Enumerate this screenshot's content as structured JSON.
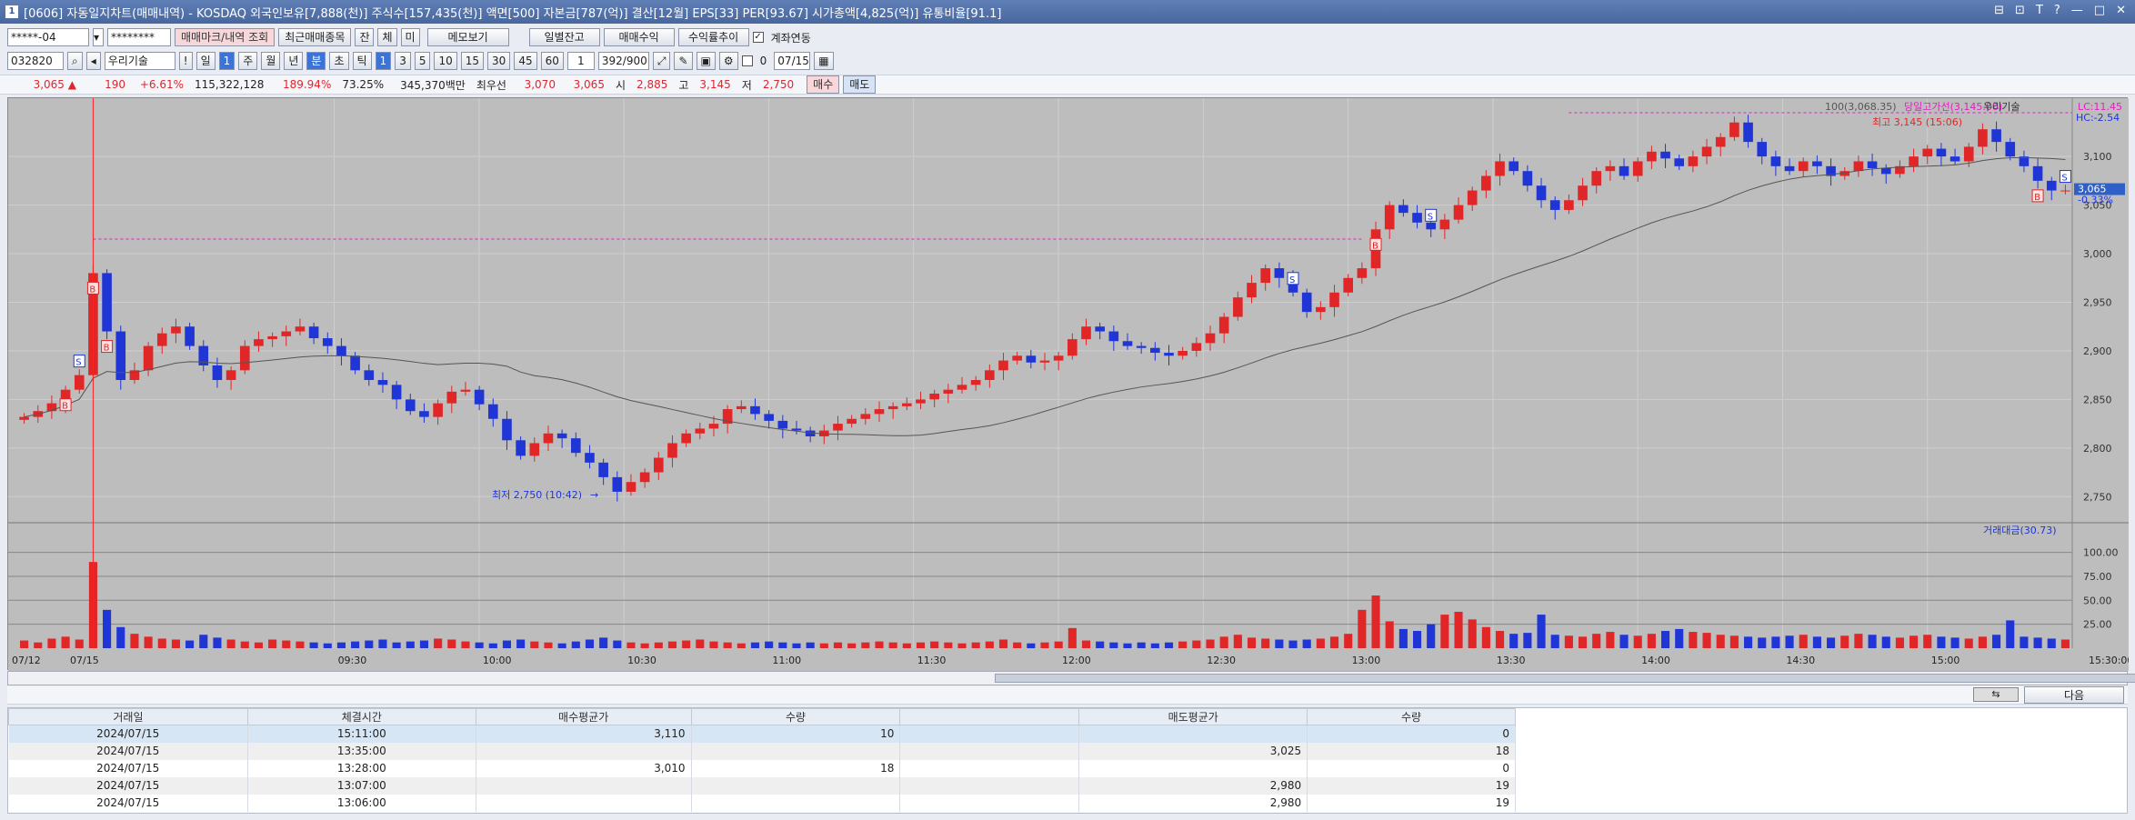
{
  "window": {
    "title": "[0606] 자동일지차트(매매내역) - KOSDAQ 외국인보유[7,888(천)] 주식수[157,435(천)] 액면[500] 자본금[787(억)] 결산[12월] EPS[33] PER[93.67] 시가총액[4,825(억)] 유통비율[91.1]",
    "controls": [
      "⊟",
      "⊡",
      "T",
      "?",
      "—",
      "□",
      "✕"
    ]
  },
  "toolbar1": {
    "account": "*****-04",
    "password": "********",
    "tab_trade_mark": "매매마크/내역 조회",
    "tab_recent": "최근매매종목",
    "btn_jan": "잔",
    "btn_che": "체",
    "btn_mi": "미",
    "btn_memo": "메모보기",
    "btn_daily": "일별잔고",
    "btn_profit": "매매수익",
    "btn_profit_trend": "수익률추이",
    "link_label": "계좌연동"
  },
  "toolbar2": {
    "code": "032820",
    "stock_name": "우리기술",
    "exclaim": "!",
    "periods": [
      "일",
      "1",
      "주",
      "월",
      "년",
      "분",
      "초",
      "틱"
    ],
    "minute_options": [
      "1",
      "3",
      "5",
      "10",
      "15",
      "30",
      "45",
      "60"
    ],
    "count_val": "1",
    "range": "392/900",
    "checkbox_val": "0",
    "date": "07/15"
  },
  "quote": {
    "price": "3,065",
    "arrow": "▲",
    "change": "190",
    "rate": "+6.61%",
    "volume": "115,322,128",
    "vol_rate": "189.94%",
    "turnover": "73.25%",
    "amount": "345,370백만",
    "pri_label": "최우선",
    "ask": "3,070",
    "bid": "3,065",
    "open_label": "시",
    "open": "2,885",
    "high_label": "고",
    "high": "3,145",
    "low_label": "저",
    "low": "2,750",
    "buy": "매수",
    "sell": "매도"
  },
  "chart_data": {
    "type": "candlestick",
    "x": [
      "07/12",
      "07/15",
      "09:30",
      "10:00",
      "10:30",
      "11:00",
      "11:30",
      "12:00",
      "12:30",
      "13:00",
      "13:30",
      "14:00",
      "14:30",
      "15:00",
      "15:30:00"
    ],
    "y_ticks": [
      "3,100",
      "3,050",
      "3,000",
      "2,950",
      "2,900",
      "2,850",
      "2,800",
      "2,750"
    ],
    "ylim": [
      2725,
      3160
    ],
    "vol_ticks": [
      "100.00",
      "75.00",
      "50.00",
      "25.00"
    ],
    "vol_ylim": [
      0,
      130
    ],
    "close_values": [
      2832,
      2838,
      2846,
      2860,
      2875,
      2980,
      2920,
      2870,
      2880,
      2905,
      2918,
      2925,
      2905,
      2885,
      2870,
      2880,
      2905,
      2912,
      2915,
      2920,
      2925,
      2913,
      2905,
      2895,
      2880,
      2870,
      2865,
      2850,
      2838,
      2832,
      2846,
      2858,
      2860,
      2845,
      2830,
      2808,
      2792,
      2805,
      2815,
      2810,
      2795,
      2785,
      2770,
      2755,
      2765,
      2775,
      2790,
      2805,
      2815,
      2820,
      2825,
      2840,
      2843,
      2835,
      2828,
      2820,
      2818,
      2812,
      2818,
      2825,
      2830,
      2835,
      2840,
      2843,
      2846,
      2850,
      2856,
      2860,
      2865,
      2870,
      2880,
      2890,
      2895,
      2888,
      2890,
      2895,
      2912,
      2925,
      2920,
      2910,
      2905,
      2903,
      2898,
      2895,
      2900,
      2908,
      2918,
      2935,
      2955,
      2970,
      2985,
      2975,
      2960,
      2940,
      2945,
      2960,
      2975,
      2985,
      3025,
      3050,
      3042,
      3032,
      3025,
      3035,
      3050,
      3065,
      3080,
      3095,
      3085,
      3070,
      3055,
      3045,
      3055,
      3070,
      3085,
      3090,
      3080,
      3095,
      3105,
      3098,
      3090,
      3100,
      3110,
      3120,
      3135,
      3115,
      3100,
      3090,
      3085,
      3095,
      3090,
      3080,
      3085,
      3095,
      3088,
      3082,
      3090,
      3100,
      3108,
      3100,
      3095,
      3110,
      3128,
      3115,
      3100,
      3090,
      3075,
      3065,
      3065
    ],
    "annotations": {
      "low": "최저 2,750 (10:42)",
      "high": "최고 3,145 (15:06)",
      "prev_high": "당일고가선(3,145.00)",
      "ma_label": "100(3,068.35)",
      "lc": "LC:11.45",
      "hc": "HC:-2.54",
      "cur_price": "3,065",
      "cur_rate": "-0.33%",
      "stock": "우리기술",
      "vol_label": "거래대금(30.73)"
    },
    "volumes": [
      8,
      6,
      10,
      12,
      9,
      90,
      40,
      22,
      15,
      12,
      10,
      9,
      8,
      14,
      11,
      9,
      7,
      6,
      9,
      8,
      7,
      6,
      5,
      6,
      7,
      8,
      9,
      6,
      7,
      8,
      10,
      9,
      7,
      6,
      5,
      8,
      9,
      7,
      6,
      5,
      7,
      9,
      11,
      8,
      6,
      5,
      6,
      7,
      8,
      9,
      7,
      6,
      5,
      6,
      7,
      6,
      5,
      6,
      5,
      6,
      5,
      6,
      7,
      6,
      5,
      6,
      7,
      6,
      5,
      6,
      7,
      9,
      6,
      5,
      6,
      7,
      21,
      8,
      7,
      6,
      5,
      6,
      5,
      6,
      7,
      8,
      9,
      12,
      14,
      11,
      10,
      9,
      8,
      9,
      10,
      12,
      15,
      40,
      55,
      28,
      20,
      18,
      25,
      35,
      38,
      30,
      22,
      18,
      15,
      16,
      35,
      14,
      13,
      12,
      15,
      17,
      14,
      13,
      15,
      18,
      20,
      17,
      16,
      14,
      13,
      12,
      11,
      12,
      13,
      14,
      12,
      11,
      13,
      15,
      14,
      12,
      11,
      13,
      14,
      12,
      11,
      10,
      12,
      14,
      29,
      12,
      11,
      10,
      9,
      8,
      20
    ],
    "marks": [
      {
        "label": "S"
      },
      {
        "label": "B"
      },
      {
        "label": "B"
      },
      {
        "label": "B"
      },
      {
        "label": "S"
      },
      {
        "label": "B"
      },
      {
        "label": "S"
      },
      {
        "label": "S"
      },
      {
        "label": "B"
      }
    ]
  },
  "bottom_nav": {
    "next": "다음"
  },
  "table": {
    "headers": [
      "거래일",
      "체결시간",
      "매수평균가",
      "수량",
      "",
      "매도평균가",
      "수량"
    ],
    "rows": [
      [
        "2024/07/15",
        "15:11:00",
        "3,110",
        "10",
        "",
        "",
        "0"
      ],
      [
        "2024/07/15",
        "13:35:00",
        "",
        "",
        "",
        "3,025",
        "18"
      ],
      [
        "2024/07/15",
        "13:28:00",
        "3,010",
        "18",
        "",
        "",
        "0"
      ],
      [
        "2024/07/15",
        "13:07:00",
        "",
        "",
        "",
        "2,980",
        "19"
      ],
      [
        "2024/07/15",
        "13:06:00",
        "",
        "",
        "",
        "2,980",
        "19"
      ]
    ]
  },
  "colors": {
    "up": "#e02626",
    "down": "#1f35d6",
    "chart_bg": "#bdbdbd",
    "ma": "#555555",
    "high_line": "#e020c0"
  }
}
